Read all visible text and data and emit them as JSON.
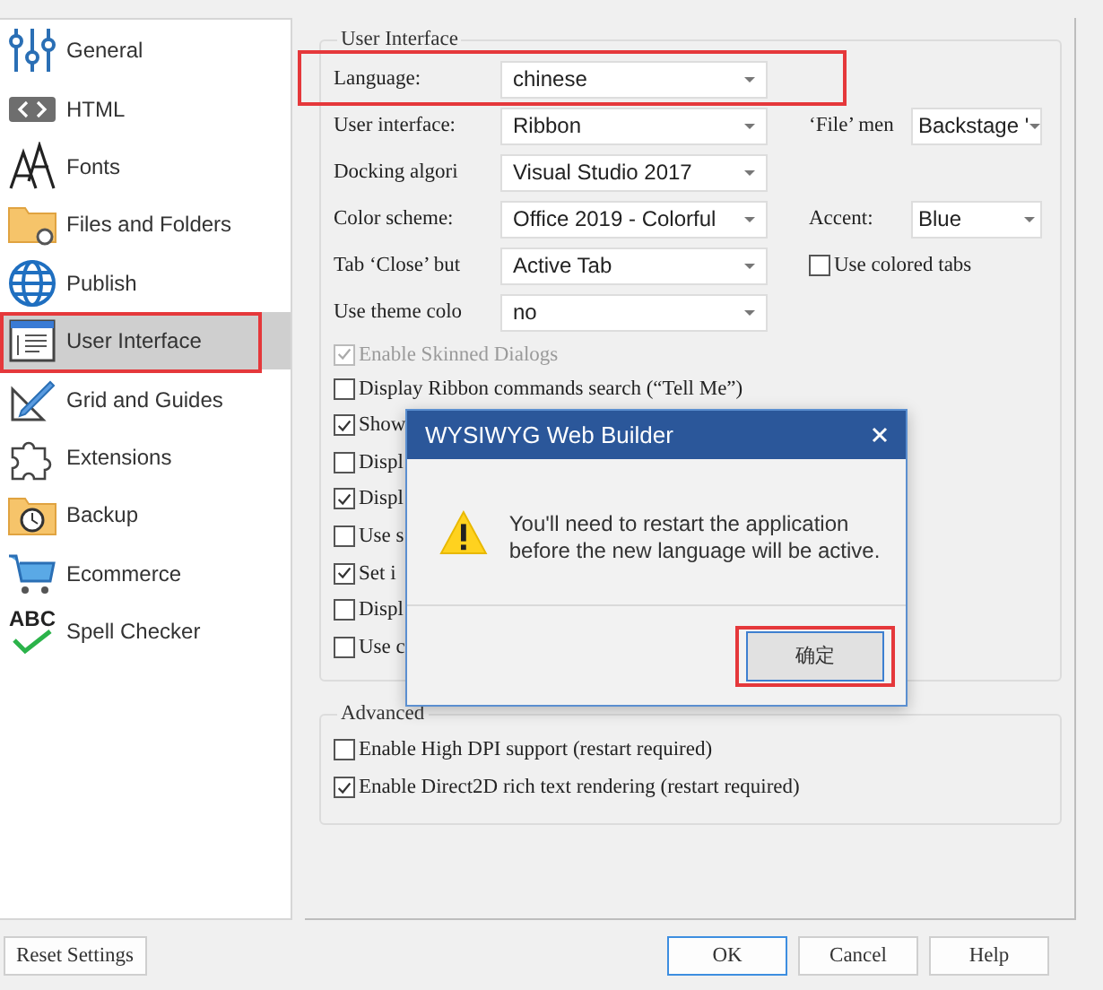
{
  "sidebar": {
    "items": [
      {
        "label": "General",
        "selected": false,
        "highlighted": false
      },
      {
        "label": "HTML",
        "selected": false,
        "highlighted": false
      },
      {
        "label": "Fonts",
        "selected": false,
        "highlighted": false
      },
      {
        "label": "Files and Folders",
        "selected": false,
        "highlighted": false
      },
      {
        "label": "Publish",
        "selected": false,
        "highlighted": false
      },
      {
        "label": "User Interface",
        "selected": true,
        "highlighted": true
      },
      {
        "label": "Grid and Guides",
        "selected": false,
        "highlighted": false
      },
      {
        "label": "Extensions",
        "selected": false,
        "highlighted": false
      },
      {
        "label": "Backup",
        "selected": false,
        "highlighted": false
      },
      {
        "label": "Ecommerce",
        "selected": false,
        "highlighted": false
      },
      {
        "label": "Spell Checker",
        "icon_text": "ABC",
        "selected": false,
        "highlighted": false
      }
    ]
  },
  "user_interface": {
    "title": "User Interface",
    "rows": [
      {
        "label": "Language:",
        "value": "chinese",
        "highlighted": true
      },
      {
        "label": "User interface:",
        "value": "Ribbon",
        "highlighted": false,
        "side": {
          "kind": "dropdown",
          "label": "‘File’ men",
          "value": "Backstage '"
        }
      },
      {
        "label": "Docking algori",
        "value": "Visual Studio 2017",
        "highlighted": false
      },
      {
        "label": "Color scheme:",
        "value": "Office 2019 - Colorful",
        "highlighted": false,
        "side": {
          "kind": "dropdown",
          "label": "Accent:",
          "value": "Blue"
        }
      },
      {
        "label": "Tab ‘Close’ but",
        "value": "Active Tab",
        "highlighted": false,
        "side": {
          "kind": "checkbox",
          "label": "Use colored tabs",
          "checked": false
        }
      },
      {
        "label": "Use theme colo",
        "value": "no",
        "highlighted": false
      }
    ],
    "checkboxes": [
      {
        "label": "Enable Skinned Dialogs",
        "checked": true,
        "disabled": true
      },
      {
        "label": "Display Ribbon commands search (“Tell Me”)",
        "checked": false,
        "disabled": false
      },
      {
        "label": "Show",
        "checked": true,
        "disabled": false
      },
      {
        "label": "Displ",
        "checked": false,
        "disabled": false
      },
      {
        "label": "Displ",
        "checked": true,
        "disabled": false
      },
      {
        "label": "Use s",
        "checked": false,
        "disabled": false
      },
      {
        "label": "Set i",
        "checked": true,
        "disabled": false
      },
      {
        "label": "Displ",
        "checked": false,
        "disabled": false
      },
      {
        "label": "Use c",
        "checked": false,
        "disabled": false
      }
    ]
  },
  "advanced": {
    "title": "Advanced",
    "checkboxes": [
      {
        "label": "Enable High DPI support (restart required)",
        "checked": false,
        "disabled": false
      },
      {
        "label": "Enable Direct2D rich text rendering (restart required)",
        "checked": true,
        "disabled": false
      }
    ]
  },
  "reset_button": "Reset Settings",
  "buttons": [
    {
      "label": "OK",
      "default": true
    },
    {
      "label": "Cancel",
      "default": false
    },
    {
      "label": "Help",
      "default": false
    }
  ],
  "dialog": {
    "title": "WYSIWYG Web Builder",
    "message": "You'll need to restart the application before the new language will be active.",
    "buttons": [
      {
        "label": "确定",
        "highlighted": true
      }
    ]
  }
}
